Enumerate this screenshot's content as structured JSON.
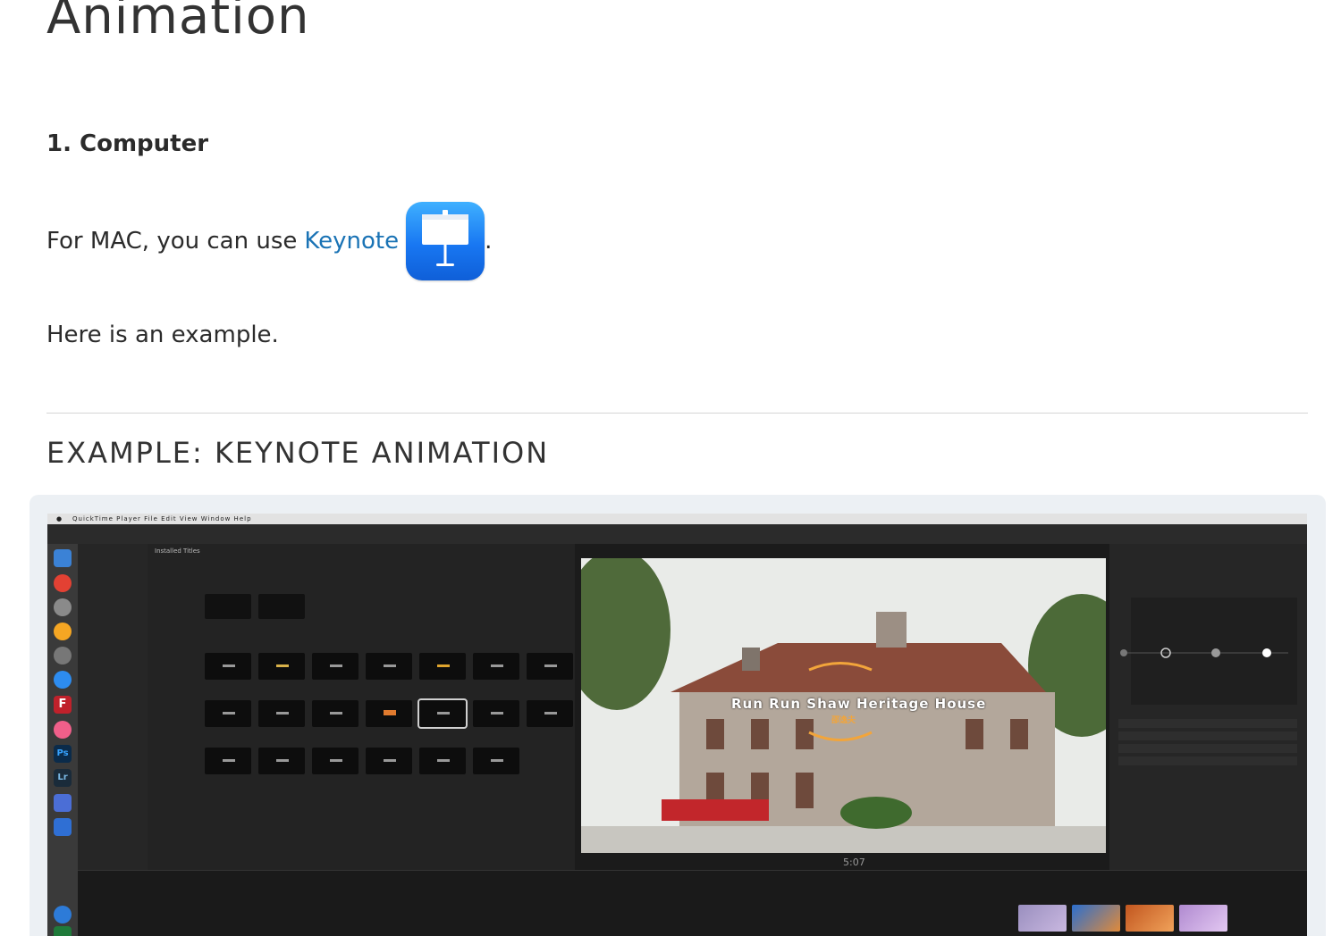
{
  "page": {
    "title": "Animation",
    "section_heading": "1. Computer",
    "mac_text": "For MAC, you can use",
    "keynote_link": "Keynote",
    "period": ".",
    "example_text": "Here is an example.",
    "example_heading": "EXAMPLE: KEYNOTE ANIMATION"
  },
  "colors": {
    "link": "#1a73b5",
    "keynote_icon_blue": "#1877f2",
    "frame_bg": "#ecf0f4"
  },
  "icons": {
    "keynote": "keynote-app-icon"
  },
  "embed": {
    "menubar_app": "QuickTime Player",
    "menubar_menus": "File  Edit  View  Window  Help",
    "titles_header": "Installed Titles",
    "overlay_title": "Run Run Shaw Heritage House",
    "overlay_sub": "邵逸夫",
    "timecode": "5:07"
  }
}
